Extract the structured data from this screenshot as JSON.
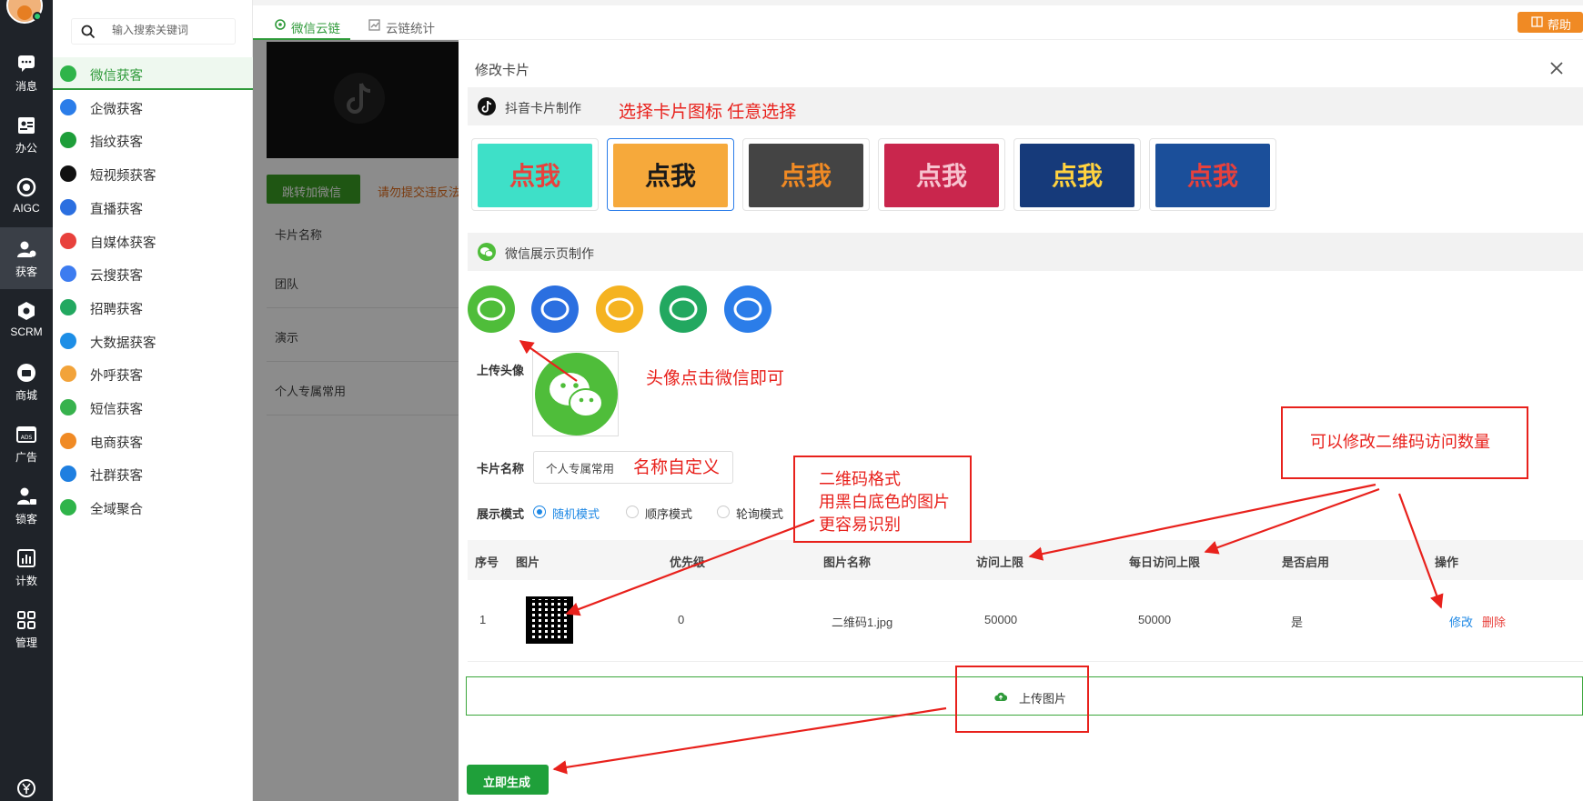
{
  "iconbar": {
    "items": [
      {
        "label": "消息",
        "icon": "message-icon"
      },
      {
        "label": "办公",
        "icon": "office-icon"
      },
      {
        "label": "AIGC",
        "icon": "aigc-icon"
      },
      {
        "label": "获客",
        "icon": "customer-icon"
      },
      {
        "label": "SCRM",
        "icon": "scrm-icon"
      },
      {
        "label": "商城",
        "icon": "store-icon"
      },
      {
        "label": "广告",
        "icon": "ads-icon"
      },
      {
        "label": "锁客",
        "icon": "lock-customer-icon"
      },
      {
        "label": "计数",
        "icon": "stats-icon"
      },
      {
        "label": "管理",
        "icon": "grid-icon"
      }
    ],
    "active_label": "获客"
  },
  "submenu": {
    "search_placeholder": "输入搜索关键词",
    "items": [
      {
        "label": "微信获客",
        "color": "#2fb44a"
      },
      {
        "label": "企微获客",
        "color": "#2b7de9"
      },
      {
        "label": "指纹获客",
        "color": "#1e9e3a"
      },
      {
        "label": "短视频获客",
        "color": "#111111"
      },
      {
        "label": "直播获客",
        "color": "#2b6fe0"
      },
      {
        "label": "自媒体获客",
        "color": "#e8413c"
      },
      {
        "label": "云搜获客",
        "color": "#3d7cf0"
      },
      {
        "label": "招聘获客",
        "color": "#22a860"
      },
      {
        "label": "大数据获客",
        "color": "#1d8ee6"
      },
      {
        "label": "外呼获客",
        "color": "#f2a33a"
      },
      {
        "label": "短信获客",
        "color": "#37b24d"
      },
      {
        "label": "电商获客",
        "color": "#f08a24"
      },
      {
        "label": "社群获客",
        "color": "#1f7fe0"
      },
      {
        "label": "全域聚合",
        "color": "#2fb44a"
      }
    ]
  },
  "tabs": [
    {
      "label": "微信云链"
    },
    {
      "label": "云链统计"
    }
  ],
  "help_label": "帮助",
  "background_page": {
    "jump_button": "跳转加微信",
    "warning": "请勿提交违反法",
    "column_header": "卡片名称",
    "rows": [
      "团队",
      "演示",
      "个人专属常用"
    ]
  },
  "dialog": {
    "title": "修改卡片",
    "douyin_section": "抖音卡片制作",
    "ann_select_icon": "选择卡片图标  任意选择",
    "cards": [
      {
        "text": "点我",
        "bg": "#3ee0c8",
        "fg": "#e8413c"
      },
      {
        "text": "点我",
        "bg": "#f6a93b",
        "fg": "#1a1a1a"
      },
      {
        "text": "点我",
        "bg": "#444444",
        "fg": "#f08a24"
      },
      {
        "text": "点我",
        "bg": "#c9264d",
        "fg": "#f7c3cf"
      },
      {
        "text": "点我",
        "bg": "#163a7a",
        "fg": "#ffd23f"
      },
      {
        "text": "点我",
        "bg": "#1b4f9a",
        "fg": "#e8413c"
      }
    ],
    "wechat_section": "微信展示页制作",
    "wx_icons": [
      {
        "icon": "wechat-icon",
        "color": "#4fbd3a"
      },
      {
        "icon": "chat-bubble-icon",
        "color": "#2b6fe0"
      },
      {
        "icon": "miniapp-icon",
        "color": "#f5b321"
      },
      {
        "icon": "moments-icon",
        "color": "#22a860"
      },
      {
        "icon": "group-icon",
        "color": "#2b7de9"
      }
    ],
    "avatar_label": "上传头像",
    "ann_avatar": "头像点击微信即可",
    "name_label": "卡片名称",
    "name_value": "个人专属常用",
    "ann_name": "名称自定义",
    "mode_label": "展示模式",
    "modes": [
      "随机模式",
      "顺序模式",
      "轮询模式"
    ],
    "ann_qr": [
      "二维码格式",
      "用黑白底色的图片",
      "更容易识别"
    ],
    "ann_visits": "可以修改二维码访问数量",
    "table": {
      "headers": [
        "序号",
        "图片",
        "优先级",
        "图片名称",
        "访问上限",
        "每日访问上限",
        "是否启用",
        "操作"
      ],
      "row": {
        "index": "1",
        "priority": "0",
        "name": "二维码1.jpg",
        "limit": "50000",
        "daily_limit": "50000",
        "enabled": "是",
        "edit": "修改",
        "delete": "删除"
      }
    },
    "upload_label": "上传图片",
    "generate_label": "立即生成"
  },
  "colors": {
    "brand_green": "#2f9a3a",
    "annotation_red": "#e8211c",
    "link_blue": "#1e88e5",
    "help_orange": "#f08a24"
  }
}
